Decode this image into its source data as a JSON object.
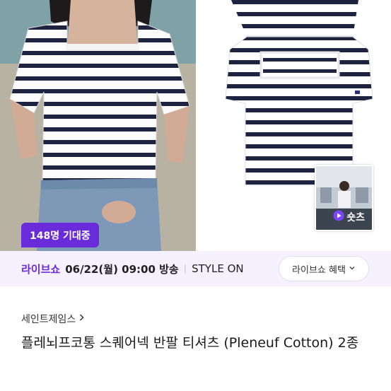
{
  "media": {
    "badge_count_text": "148명 기대중",
    "shorts_label": "숏츠"
  },
  "live": {
    "tag": "라이브쇼",
    "datetime": "06/22(월) 09:00 방송",
    "separator": "|",
    "store": "STYLE ON",
    "benefit_label": "라이브쇼 혜택"
  },
  "product": {
    "brand": "세인트제임스",
    "title": "플레뇌프코통 스퀘어넥 반팔 티셔츠 (Pleneuf Cotton) 2종"
  },
  "colors": {
    "accent": "#6a2bd9",
    "live_bar_bg": "#f6f1fe",
    "stripe_navy": "#1e2340"
  },
  "icons": {
    "brand_arrow": "chevron-right-icon",
    "benefit_arrow": "chevron-down-icon",
    "shorts": "play-icon"
  }
}
